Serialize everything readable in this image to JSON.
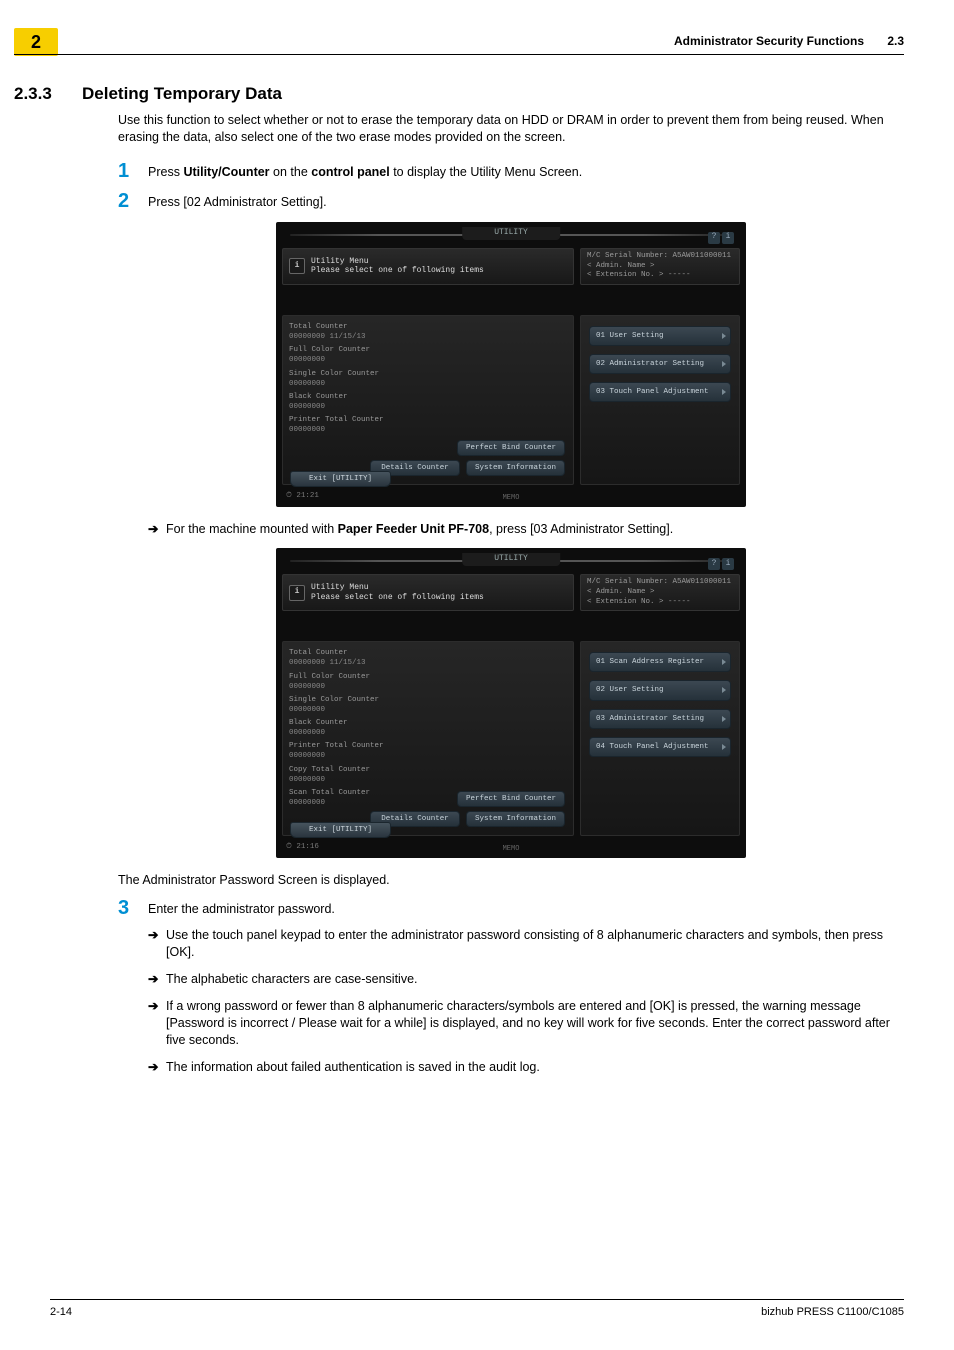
{
  "header": {
    "chapter": "2",
    "title_right": "Administrator Security Functions",
    "section_right": "2.3"
  },
  "section": {
    "number": "2.3.3",
    "title": "Deleting Temporary Data",
    "intro": "Use this function to select whether or not to erase the temporary data on HDD or DRAM in order to prevent them from being reused. When erasing the data, also select one of the two erase modes provided on the screen."
  },
  "steps": {
    "s1_pre": "Press ",
    "s1_b1": "Utility/Counter",
    "s1_mid": " on the ",
    "s1_b2": "control panel",
    "s1_post": " to display the Utility Menu Screen.",
    "s2": "Press [02 Administrator Setting].",
    "s2_arrow_pre": "For the machine mounted with ",
    "s2_arrow_b": "Paper Feeder Unit PF-708",
    "s2_arrow_post": ", press [03 Administrator Setting].",
    "password_caption": "The Administrator Password Screen is displayed.",
    "s3": "Enter the administrator password.",
    "s3_bullets": [
      "Use the touch panel keypad to enter the administrator password consisting of 8 alphanumeric characters and symbols, then press [OK].",
      "The alphabetic characters are case-sensitive.",
      "If a wrong password or fewer than 8 alphanumeric characters/symbols are entered and [OK] is pressed, the warning message [Password is incorrect / Please wait for a while] is displayed, and no key will work for five seconds. Enter the correct password after five seconds.",
      "The information about failed authentication is saved in the audit log."
    ]
  },
  "dev_common": {
    "tab": "UTILITY",
    "title1": "Utility Menu",
    "title2": "Please select one of following items",
    "serial": "M/C Serial Number: A5AW011000011",
    "admin": "< Admin. Name >",
    "ext": "< Extension No. >  -----",
    "perfect_bind": "Perfect Bind Counter",
    "details": "Details Counter",
    "sysinfo": "System Information",
    "exit": "Exit [UTILITY]",
    "memo": "MEMO"
  },
  "dev1": {
    "clock": "21:21",
    "counters": [
      "Total Counter",
      "00000000   11/15/13",
      "Full Color Counter",
      "00000000",
      "Single Color Counter",
      "00000000",
      "Black Counter",
      "00000000",
      "Printer Total Counter",
      "00000000"
    ],
    "menu": [
      "01 User Setting",
      "02 Administrator Setting",
      "03 Touch Panel Adjustment"
    ]
  },
  "dev2": {
    "clock": "21:16",
    "counters": [
      "Total Counter",
      "00000000   11/15/13",
      "Full Color Counter",
      "00000000",
      "Single Color Counter",
      "00000000",
      "Black Counter",
      "00000000",
      "Printer Total Counter",
      "00000000",
      "Copy Total Counter",
      "00000000",
      "Scan Total Counter",
      "00000000"
    ],
    "menu": [
      "01 Scan Address Register",
      "02 User Setting",
      "03 Administrator Setting",
      "04 Touch Panel Adjustment"
    ]
  },
  "footer": {
    "left": "2-14",
    "right": "bizhub PRESS C1100/C1085"
  }
}
